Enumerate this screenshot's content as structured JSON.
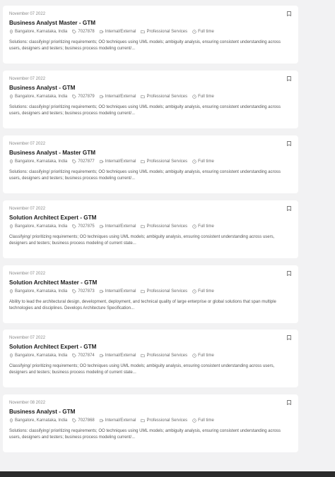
{
  "jobs": [
    {
      "date": "November 07 2022",
      "title": "Business Analyst Master - GTM",
      "location": "Bangalore, Karnataka, India",
      "id": "7027878",
      "type": "Internal/External",
      "category": "Professional Services",
      "schedule": "Full time",
      "description": "Solutions: classifying/ prioritizing requirements; OO techniques using UML models; ambiguity analysis, ensuring consistent understanding across users, designers and testers; business process modeling current/..."
    },
    {
      "date": "November 07 2022",
      "title": "Business Analyst - GTM",
      "location": "Bangalore, Karnataka, India",
      "id": "7027879",
      "type": "Internal/External",
      "category": "Professional Services",
      "schedule": "Full time",
      "description": "Solutions: classifying/ prioritizing requirements; OO techniques using UML models; ambiguity analysis, ensuring consistent understanding across users, designers and testers; business process modeling current/..."
    },
    {
      "date": "November 07 2022",
      "title": "Business Analyst - Master GTM",
      "location": "Bangalore, Karnataka, India",
      "id": "7027877",
      "type": "Internal/External",
      "category": "Professional Services",
      "schedule": "Full time",
      "description": "Solutions: classifying/ prioritizing requirements; OO techniques using UML models; ambiguity analysis, ensuring consistent understanding across users, designers and testers; business process modeling current/..."
    },
    {
      "date": "November 07 2022",
      "title": "Solution Architect Expert - GTM",
      "location": "Bangalore, Karnataka, India",
      "id": "7027875",
      "type": "Internal/External",
      "category": "Professional Services",
      "schedule": "Full time",
      "description": "Classifying/ prioritizing requirements; OO techniques using UML models; ambiguity analysis, ensuring consistent understanding across users, designers and testers; business process modeling of current state..."
    },
    {
      "date": "November 07 2022",
      "title": "Solution Architect Master - GTM",
      "location": "Bangalore, Karnataka, India",
      "id": "7027873",
      "type": "Internal/External",
      "category": "Professional Services",
      "schedule": "Full time",
      "description": "Ability to lead the architectural design, development, deployment, and technical quality of large enterprise or global solutions that span multiple technologies and disciplines. Develops Architecture Specification..."
    },
    {
      "date": "November 07 2022",
      "title": "Solution Architect Expert - GTM",
      "location": "Bangalore, Karnataka, India",
      "id": "7027874",
      "type": "Internal/External",
      "category": "Professional Services",
      "schedule": "Full time",
      "description": "Classifying/ prioritizing requirements; OO techniques using UML models; ambiguity analysis, ensuring consistent understanding across users, designers and testers; business process modeling of current state..."
    },
    {
      "date": "November 08 2022",
      "title": "Business Analyst - GTM",
      "location": "Bangalore, Karnataka, India",
      "id": "7027868",
      "type": "Internal/External",
      "category": "Professional Services",
      "schedule": "Full time",
      "description": "Solutions: classifying/ prioritizing requirements; OO techniques using UML models; ambiguity analysis, ensuring consistent understanding across users, designers and testers; business process modeling current/..."
    }
  ],
  "icons": {
    "location": "location-pin-icon",
    "id": "tag-icon",
    "type": "share-icon",
    "category": "folder-icon",
    "schedule": "clock-icon",
    "save": "bookmark-icon"
  }
}
